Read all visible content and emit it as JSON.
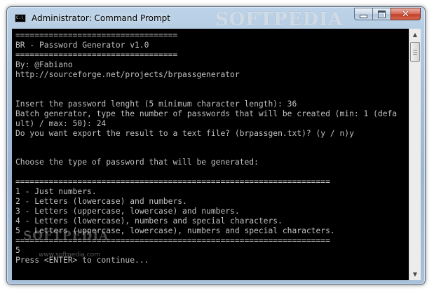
{
  "window": {
    "title": "Administrator: Command Prompt",
    "icon_label": "C:\\",
    "watermark": "SOFTPEDIA",
    "controls": {
      "minimize": "minimize-icon",
      "maximize": "maximize-icon",
      "close": "close-icon",
      "close_glyph": "✕"
    }
  },
  "console": {
    "lines": [
      "==================================",
      "BR - Password Generator v1.0",
      "==================================",
      "By: @Fabiano",
      "http://sourceforge.net/projects/brpassgenerator",
      "",
      "",
      "Insert the password lenght (5 minimum character length): 36",
      "Batch generator, type the number of passwords that will be created (min: 1 (defa",
      "ult) / max: 50): 24",
      "Do you want export the result to a text file? (brpassgen.txt)? (y / n)y",
      "",
      "",
      "Choose the type of password that will be generated:",
      "",
      "==================================================================",
      "1 - Just numbers.",
      "2 - Letters (lowercase) and numbers.",
      "3 - Letters (uppercase, lowercase) and numbers.",
      "4 - Letters (lowercase), numbers and special characters.",
      "5 - Letters (uppercase, lowercase), numbers and special characters.",
      "==================================================================",
      "5",
      "Press <ENTER> to continue..."
    ],
    "text_color": "#c0c0c0",
    "background": "#000000"
  },
  "scrollbar": {
    "up_arrow": "▲",
    "down_arrow": "▼"
  },
  "watermarks": {
    "lower_logo": "SOFTPEDIA",
    "url": "www.softpedia.com"
  }
}
